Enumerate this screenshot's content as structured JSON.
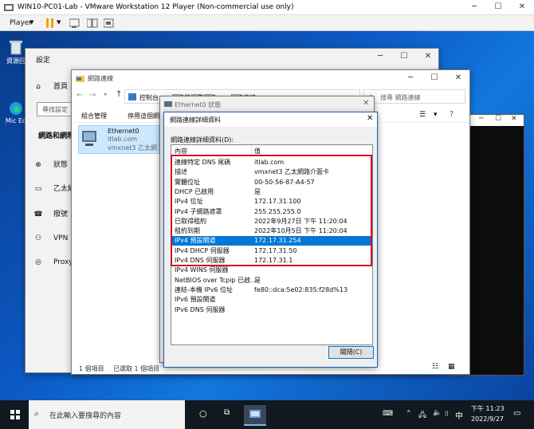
{
  "vmware": {
    "title": "WIN10-PC01-Lab - VMware Workstation 12 Player (Non-commercial use only)",
    "player_label": "Player"
  },
  "desktop": {
    "recycle_label": "資源回",
    "edge_label": "Mic Ed"
  },
  "settings": {
    "title": "設定",
    "home": "首頁",
    "search_placeholder": "尋找設定",
    "section": "網路和網際",
    "items": [
      "狀態",
      "乙太網",
      "撥號",
      "VPN",
      "Proxy"
    ]
  },
  "netconn": {
    "title": "網路連線",
    "breadcrumb": [
      "控制台",
      "網路和網際網路",
      "網路連線"
    ],
    "search_placeholder": "搜尋 網路連線",
    "toolbar": [
      "組合管理",
      "停用這個網"
    ],
    "adapter": {
      "name": "Ethernet0",
      "network": "itlab.com",
      "device": "vmxnet3 乙太網"
    },
    "status": {
      "count": "1 個項目",
      "selected": "已選取 1 個項目"
    }
  },
  "eth_status": {
    "title": "Ethernet0 狀態"
  },
  "details": {
    "title": "網路連線詳細資料",
    "label": "網路連線詳細資料(D):",
    "col_prop": "內容",
    "col_val": "值",
    "rows": [
      {
        "k": "連線特定 DNS 尾碼",
        "v": "itlab.com"
      },
      {
        "k": "描述",
        "v": "vmxnet3 乙太網路介面卡"
      },
      {
        "k": "實體位址",
        "v": "00-50-56-87-A4-57"
      },
      {
        "k": "DHCP 已啟用",
        "v": "是"
      },
      {
        "k": "IPv4 位址",
        "v": "172.17.31.100"
      },
      {
        "k": "IPv4 子網路遮罩",
        "v": "255.255.255.0"
      },
      {
        "k": "已取得租約",
        "v": "2022年9月27日 下午 11:20:04"
      },
      {
        "k": "租約到期",
        "v": "2022年10月5日 下午 11:20:04"
      },
      {
        "k": "IPv4 預設閘道",
        "v": "172.17.31.254"
      },
      {
        "k": "IPv4 DHCP 伺服器",
        "v": "172.17.31.50"
      },
      {
        "k": "IPv4 DNS 伺服器",
        "v": "172.17.31.1"
      },
      {
        "k": "IPv4 WINS 伺服器",
        "v": ""
      },
      {
        "k": "NetBIOS over Tcpip 已啟...",
        "v": "是"
      },
      {
        "k": "連結-本機 IPv6 位址",
        "v": "fe80::dca:5e02:835:f28d%13"
      },
      {
        "k": "IPv6 預設閘道",
        "v": ""
      },
      {
        "k": "IPv6 DNS 伺服器",
        "v": ""
      }
    ],
    "selected_index": 8,
    "close_label": "關閉(C)"
  },
  "taskbar": {
    "search_placeholder": "在此輸入要搜尋的內容",
    "ime": "中",
    "time": "下午 11:23",
    "date": "2022/9/27"
  },
  "colors": {
    "highlight": "#0078d7",
    "annotation": "#d0102a",
    "vmware_pause": "#f0a000"
  }
}
